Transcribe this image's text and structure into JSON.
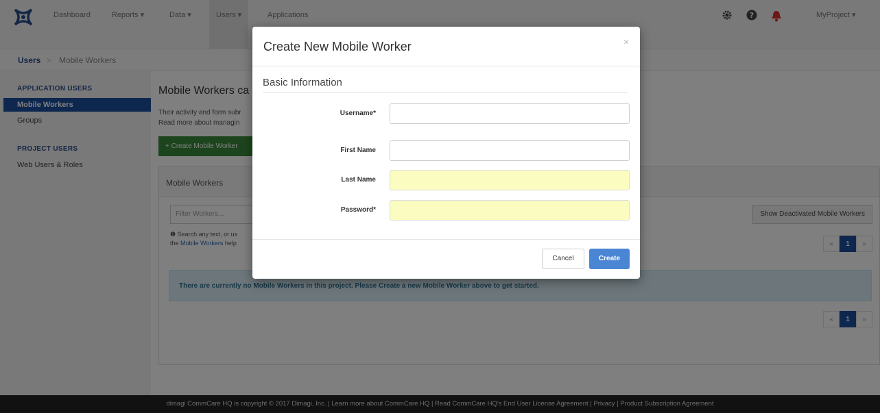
{
  "nav": {
    "items": [
      "Dashboard",
      "Reports ▾",
      "Data ▾",
      "Users ▾",
      "Applications"
    ],
    "project": "MyProject ▾",
    "icons": [
      "gear-icon",
      "help-icon",
      "bell-icon"
    ]
  },
  "breadcrumb": {
    "root": "Users",
    "sep": ">",
    "current": "Mobile Workers"
  },
  "sidebar": {
    "section1": "APPLICATION USERS",
    "items1": [
      "Mobile Workers",
      "Groups"
    ],
    "section2": "PROJECT USERS",
    "items2": [
      "Web Users & Roles"
    ]
  },
  "main": {
    "title": "Mobile Workers ca",
    "line1": "Their activity and form subr",
    "line2": "Read more about managin",
    "create_btn": "+ Create Mobile Worker",
    "panel_title": "Mobile Workers",
    "filter_placeholder": "Filter Workers...",
    "help_line1": "❶ Search any text, or us",
    "help_line2_pre": "the ",
    "help_link": "Mobile Workers",
    "help_line2_post": " help",
    "deactivated_btn": "Show Deactivated Mobile Workers",
    "alert": "There are currently no Mobile Workers in this project. Please Create a new Mobile Worker above to get started.",
    "pager": [
      "«",
      "1",
      "»"
    ]
  },
  "footer": {
    "text": "dimagi  CommCare HQ is copyright © 2017 Dimagi, Inc.  |  Learn more about CommCare HQ  |  Read CommCare HQ's End User License Agreement  |  Privacy  |  Product Subscription Agreement"
  },
  "modal": {
    "title": "Create New Mobile Worker",
    "close": "×",
    "legend": "Basic Information",
    "fields": [
      {
        "label": "Username*",
        "value": ""
      },
      {
        "label": "First Name",
        "value": ""
      },
      {
        "label": "Last Name",
        "value": ""
      },
      {
        "label": "Password*",
        "value": ""
      }
    ],
    "cancel": "Cancel",
    "create": "Create"
  }
}
